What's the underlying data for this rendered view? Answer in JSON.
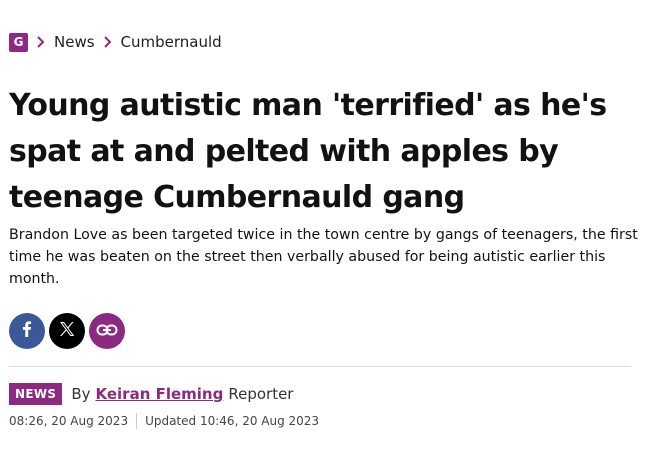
{
  "breadcrumb": {
    "logo_letter": "G",
    "items": [
      "News",
      "Cumbernauld"
    ]
  },
  "article": {
    "headline": "Young autistic man 'terrified' as he's spat at and pelted with apples by teenage Cumbernauld gang",
    "standfirst": "Brandon Love as been targeted twice in the town centre by gangs of teenagers, the first time he was beaten on the street then verbally abused for being autistic earlier this month."
  },
  "share": {
    "buttons": [
      {
        "name": "facebook",
        "icon": "facebook-icon",
        "color": "#3b5998"
      },
      {
        "name": "x",
        "icon": "x-icon",
        "color": "#000000"
      },
      {
        "name": "copy-link",
        "icon": "link-icon",
        "color": "#8c2a82"
      }
    ]
  },
  "byline": {
    "badge": "NEWS",
    "by": "By",
    "author": "Keiran Fleming",
    "role": "Reporter",
    "published": "08:26, 20 Aug 2023",
    "updated": "Updated 10:46, 20 Aug 2023"
  },
  "colors": {
    "brand": "#8c2a82",
    "text": "#121212",
    "facebook": "#3b5998"
  }
}
